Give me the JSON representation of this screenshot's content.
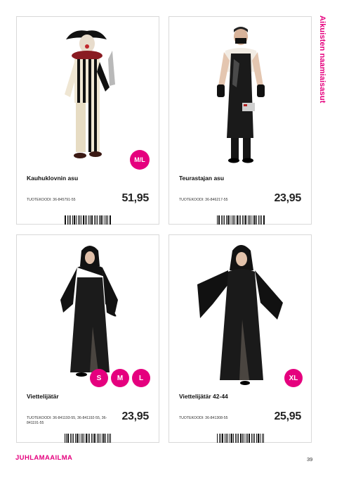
{
  "side_title": "Aikuisten naamiaisasut",
  "footer": {
    "brand": "JUHLAMAAILMA",
    "page_number": "39"
  },
  "products": [
    {
      "name": "Kauhuklovnin asu",
      "code": "TUOTEKOODI: 36-845791-55",
      "price": "51,95",
      "sizes": [
        "M/L"
      ],
      "image_icon": "clown-costume-image"
    },
    {
      "name": "Teurastajan asu",
      "code": "TUOTEKOODI: 36-846217-55",
      "price": "23,95",
      "sizes": [],
      "image_icon": "butcher-costume-image"
    },
    {
      "name": "Viettelijätär",
      "code": "TUOTEKOODI: 36-841193-55, 36-841192-55, 36-841191-55",
      "price": "23,95",
      "sizes": [
        "S",
        "M",
        "L"
      ],
      "image_icon": "sorceress-costume-image"
    },
    {
      "name": "Viettelijätär 42-44",
      "code": "TUOTEKOODI: 36-841308-55",
      "price": "25,95",
      "sizes": [
        "XL"
      ],
      "image_icon": "sorceress-plus-costume-image"
    }
  ],
  "colors": {
    "accent": "#e5007e",
    "card_border": "#d9d9d9"
  }
}
